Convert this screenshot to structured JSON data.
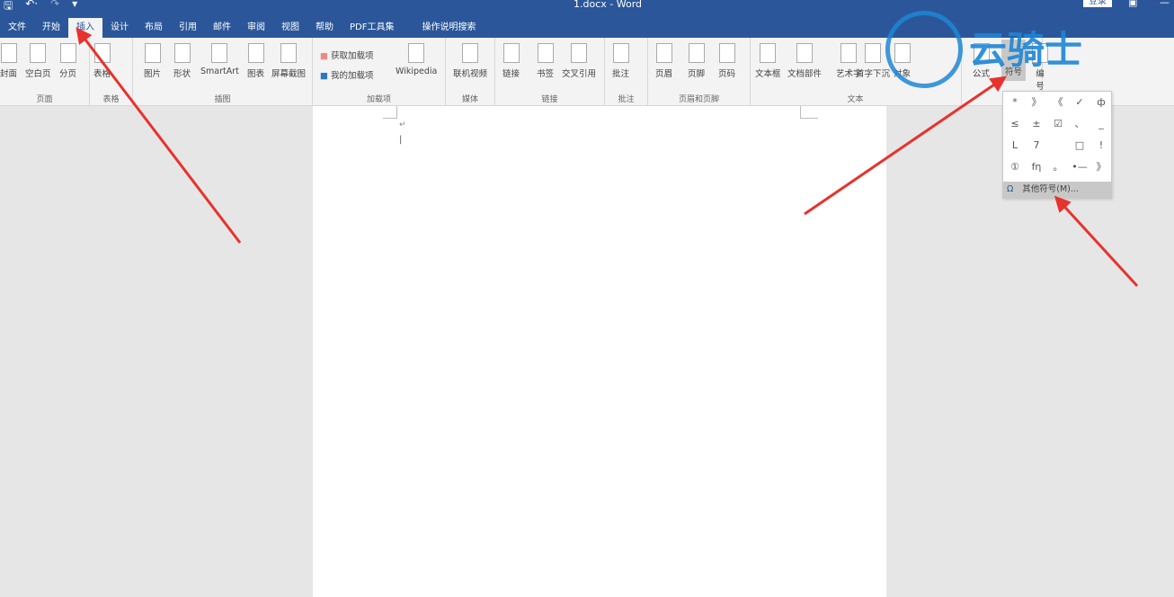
{
  "title_bar": {
    "title": "1.docx  -  Word",
    "login": "登录",
    "qat": [
      "save-icon",
      "undo-icon",
      "redo-icon",
      "customize-icon"
    ]
  },
  "tabs": [
    "文件",
    "开始",
    "插入",
    "设计",
    "布局",
    "引用",
    "邮件",
    "审阅",
    "视图",
    "帮助",
    "PDF工具集",
    "操作说明搜索"
  ],
  "active_tab": "插入",
  "ribbon": {
    "groups": [
      {
        "label": "页面",
        "buttons": [
          "封面",
          "空白页",
          "分页"
        ]
      },
      {
        "label": "表格",
        "buttons": [
          "表格"
        ]
      },
      {
        "label": "插图",
        "buttons": [
          "图片",
          "形状",
          "SmartArt",
          "图表",
          "屏幕截图"
        ]
      },
      {
        "label": "加载项",
        "buttons": [
          "获取加载项",
          "我的加载项",
          "Wikipedia"
        ]
      },
      {
        "label": "媒体",
        "buttons": [
          "联机视频"
        ]
      },
      {
        "label": "链接",
        "buttons": [
          "链接",
          "书签",
          "交叉引用"
        ]
      },
      {
        "label": "批注",
        "buttons": [
          "批注"
        ]
      },
      {
        "label": "页眉和页脚",
        "buttons": [
          "页眉",
          "页脚",
          "页码"
        ]
      },
      {
        "label": "文本",
        "buttons": [
          "文本框",
          "文档部件",
          "艺术字",
          "首字下沉",
          "对象"
        ]
      },
      {
        "label": "",
        "buttons": [
          "公式",
          "符号",
          "编号"
        ]
      }
    ]
  },
  "symbol_menu": {
    "symbols": [
      "*",
      "》",
      "《",
      "✓",
      "ф",
      "≤",
      "±",
      "☑",
      "、",
      "_",
      "L",
      "7",
      "",
      "□",
      "!",
      "①",
      "fη",
      "。",
      "•—",
      "》"
    ],
    "more": "其他符号(M)..."
  },
  "document": {
    "paragraph_marks": [
      "↵",
      "↵"
    ]
  },
  "watermark": "云骑士",
  "colors": {
    "title_bar": "#2b579a",
    "arrow": "#e8322d",
    "watermark": "#1d86d6"
  }
}
